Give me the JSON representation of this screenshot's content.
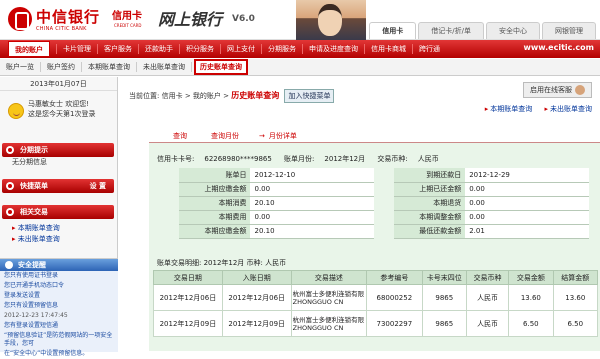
{
  "brand": {
    "bank_cn": "中信银行",
    "bank_en": "CHINA CITIC BANK",
    "card_cn": "信用卡",
    "card_en": "CREDIT CARD",
    "netbank": "网上银行",
    "version": "V6.0"
  },
  "top_tabs": [
    "信用卡",
    "借记卡/折/单",
    "安全中心",
    "网银管理"
  ],
  "nav": {
    "my": "我的账户",
    "items": [
      "卡片管理",
      "客户服务",
      "还款助手",
      "积分服务",
      "网上支付",
      "分期服务",
      "申请及进度查询",
      "信用卡商城",
      "跨行通"
    ],
    "url": "www.ecitic.com"
  },
  "subnav": [
    "账户一览",
    "账户签约",
    "本期账单查询",
    "未出账单查询",
    "历史账单查询"
  ],
  "sidebar": {
    "date": "2013年01月07日",
    "welcome_line1": "马惠敏女士 欢迎您!",
    "welcome_line2": "这是您今天第1次登录",
    "section1": "分期提示",
    "section1_item": "无分期信息",
    "section2": "快捷菜单",
    "section2_set": "设 置",
    "section3": "相关交易",
    "related": [
      "本期账单查询",
      "未出账单查询"
    ],
    "security": {
      "title": "安全提醒",
      "lines": [
        "您只有使用证书登录",
        "您已开通手机动态口令",
        "登录发送设置",
        "您只有设置预留信息",
        "2012-12-23 17:47:45",
        "您有登录设置短信通",
        "“预留信息验证”是防范假网站的一项安全手段，您可",
        "在“安全中心”中设置预留信息。"
      ]
    }
  },
  "main": {
    "crumb_prefix": "当前位置:",
    "crumb_path": "信用卡 > 我的账户 >",
    "crumb_current": "历史账单查询",
    "add_fav": "加入快捷菜单",
    "online_service": "启用在线客服",
    "quick_links": [
      "本期账单查询",
      "未出账单查询"
    ],
    "steps": [
      "查询",
      "查询月份",
      "月份详单"
    ],
    "card_no_label": "信用卡卡号:",
    "card_no": "62268980****9865",
    "month_label": "账单月份:",
    "month": "2012年12月",
    "currency_label": "交易币种:",
    "currency": "人民币",
    "summary": [
      {
        "l": "账单日",
        "v": "2012-12-10",
        "l2": "到期还款日",
        "v2": "2012-12-29"
      },
      {
        "l": "上期应缴金额",
        "v": "0.00",
        "l2": "上期已还金额",
        "v2": "0.00"
      },
      {
        "l": "本期消费",
        "v": "20.10",
        "l2": "本期退货",
        "v2": "0.00"
      },
      {
        "l": "本期费用",
        "v": "0.00",
        "l2": "本期调整金额",
        "v2": "0.00"
      },
      {
        "l": "本期应缴金额",
        "v": "20.10",
        "l2": "最低还款金额",
        "v2": "2.01"
      }
    ],
    "detail_title": "账单交易明细: 2012年12月 币种:",
    "detail_currency": "人民币",
    "columns": [
      "交易日期",
      "入账日期",
      "交易描述",
      "参考编号",
      "卡号末四位",
      "交易币种",
      "交易金额",
      "结算金额"
    ],
    "rows": [
      [
        "2012年12月06日",
        "2012年12月06日",
        "杭州富士多便利连锁有限 ZHONGGUO CN",
        "68000252",
        "9865",
        "人民币",
        "13.60",
        "13.60"
      ],
      [
        "2012年12月09日",
        "2012年12月09日",
        "杭州富士多便利连锁有限 ZHONGGUO CN",
        "73002297",
        "9865",
        "人民币",
        "6.50",
        "6.50"
      ]
    ]
  }
}
